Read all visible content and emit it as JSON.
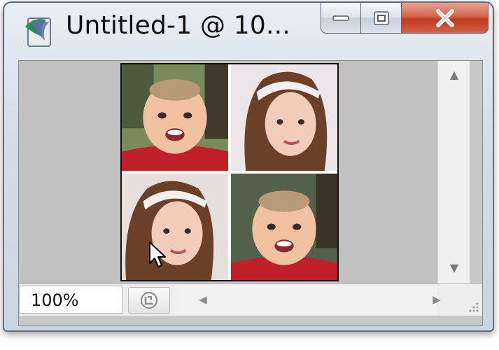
{
  "window": {
    "title": "Untitled-1 @ 10...",
    "controls": {
      "minimize": "minimize-icon",
      "maximize": "restore-icon",
      "close": "close-icon"
    }
  },
  "canvas": {
    "photos": [
      {
        "subject": "baby-photo",
        "tone": "#7a8a5a"
      },
      {
        "subject": "girl-photo",
        "tone": "#e8e2e6"
      },
      {
        "subject": "girl-photo",
        "tone": "#d9d2cf"
      },
      {
        "subject": "baby-photo",
        "tone": "#54614a"
      }
    ]
  },
  "statusbar": {
    "zoom_value": "100%",
    "status_icon": "document-info-icon"
  },
  "colors": {
    "close_button": "#c9472b",
    "canvas_bg": "#c1c1c1",
    "scrollbar": "#f0f0f0"
  }
}
